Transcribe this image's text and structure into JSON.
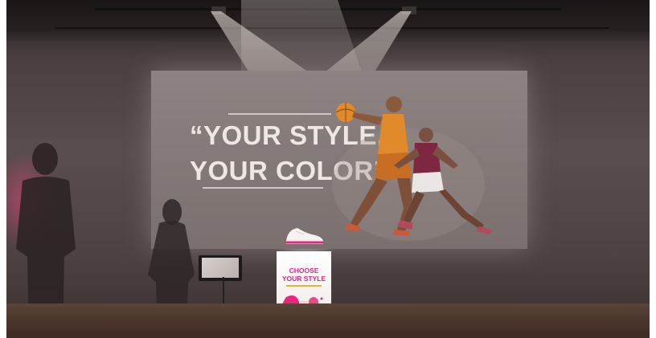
{
  "screen": {
    "headline_line1": "“YOUR STYLE,",
    "headline_line2": "YOUR COLOR”"
  },
  "pedestal": {
    "title_line1": "CHOOSE",
    "title_line2": "YOUR STYLE"
  },
  "colors": {
    "accent_pink": "#e6267f",
    "projection_text": "#efe7e4",
    "jersey_orange": "#e08a2c",
    "jersey_maroon": "#7d2740"
  },
  "icons": [
    "sneaker-icon",
    "footprint-icon",
    "color-swatch-icon"
  ]
}
